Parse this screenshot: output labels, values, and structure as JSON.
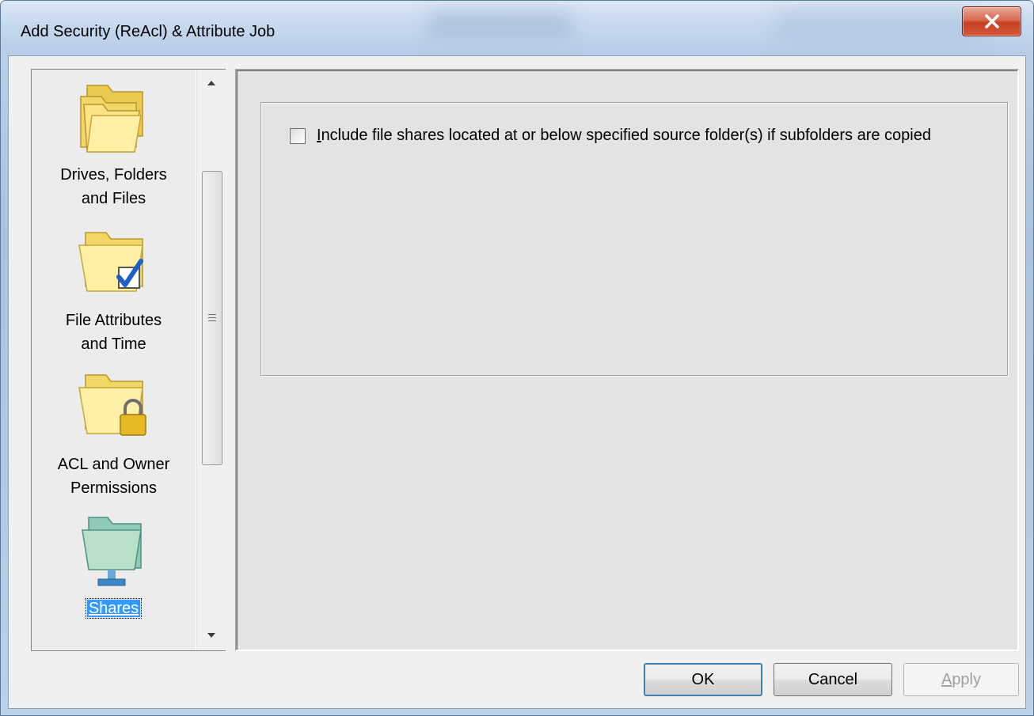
{
  "window": {
    "title": "Add Security (ReAcl) & Attribute Job",
    "close_icon": "close-x-icon"
  },
  "nav": {
    "items": [
      {
        "label_line1": "Drives, Folders",
        "label_line2": "and Files",
        "icon": "folders-icon",
        "selected": false
      },
      {
        "label_line1": "File Attributes",
        "label_line2": "and Time",
        "icon": "folder-checkmark-icon",
        "selected": false
      },
      {
        "label_line1": "ACL and Owner",
        "label_line2": "Permissions",
        "icon": "folder-lock-icon",
        "selected": false
      },
      {
        "label_line1": "Shares",
        "label_line2": "",
        "icon": "network-share-folder-icon",
        "selected": true
      }
    ]
  },
  "shares": {
    "include_subfolder_shares": {
      "checked": false,
      "label_first": "I",
      "label_rest": "nclude file shares located at or below specified source folder(s) if subfolders are copied"
    }
  },
  "buttons": {
    "ok": "OK",
    "cancel": "Cancel",
    "apply_first": "A",
    "apply_rest": "pply",
    "apply_enabled": false
  },
  "colors": {
    "selection_highlight": "#3399ff",
    "close_button": "#c7401f",
    "folder_yellow": "#f8d85a"
  }
}
